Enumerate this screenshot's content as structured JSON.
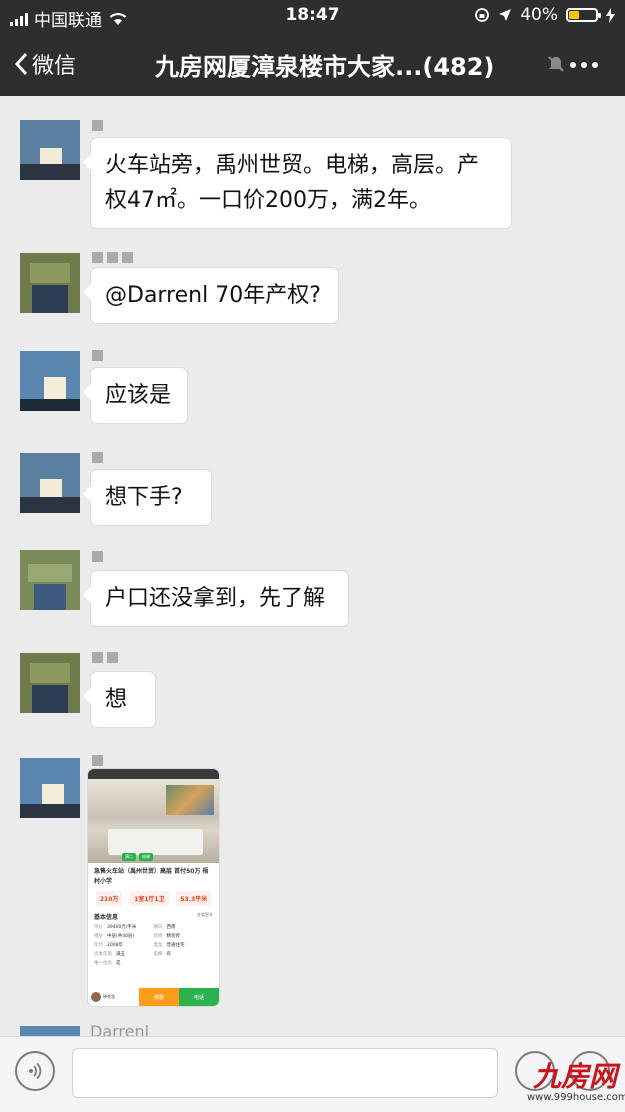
{
  "status_bar": {
    "carrier": "中国联通",
    "time": "18:47",
    "battery": "40%",
    "battery_level": 0.4
  },
  "nav": {
    "back_label": "微信",
    "title": "九房网厦漳泉楼市大家...(482)"
  },
  "messages": [
    {
      "text": "火车站旁，禹州世贸。电梯，高层。产权47㎡。一口价200万，满2年。"
    },
    {
      "text": "@Darrenl 70年产权?"
    },
    {
      "text": "应该是"
    },
    {
      "text": "想下手?"
    },
    {
      "text": "户口还没拿到，先了解"
    },
    {
      "text": "想"
    }
  ],
  "listing_card": {
    "title": "急售火车站（禹州世贸）高层 首付50万 梧村小学",
    "tags": [
      "满二",
      "电梯"
    ],
    "prices": [
      "210万",
      "1室1厅1卫",
      "53.3平米"
    ],
    "section_title": "基本信息",
    "section_link": "查看更多",
    "rows": [
      [
        [
          "单价",
          "39400元/平米"
        ],
        [
          "朝向",
          "西南"
        ]
      ],
      [
        [
          "楼层",
          "中层(共40层)"
        ],
        [
          "装修",
          "精装修"
        ]
      ],
      [
        [
          "年代",
          "2008年"
        ],
        [
          "类型",
          "普通住宅"
        ]
      ],
      [
        [
          "房本年限",
          "满五"
        ],
        [
          "电梯",
          "有"
        ]
      ],
      [
        [
          "唯一住房",
          "是"
        ],
        [
          "",
          ""
        ]
      ]
    ],
    "agent_name": "钟秀龙",
    "btn_message": "微聊",
    "btn_call": "电话"
  },
  "partial_sender": "Darrenl",
  "watermark": {
    "logo": "九房网",
    "url": "www.999house.com"
  }
}
